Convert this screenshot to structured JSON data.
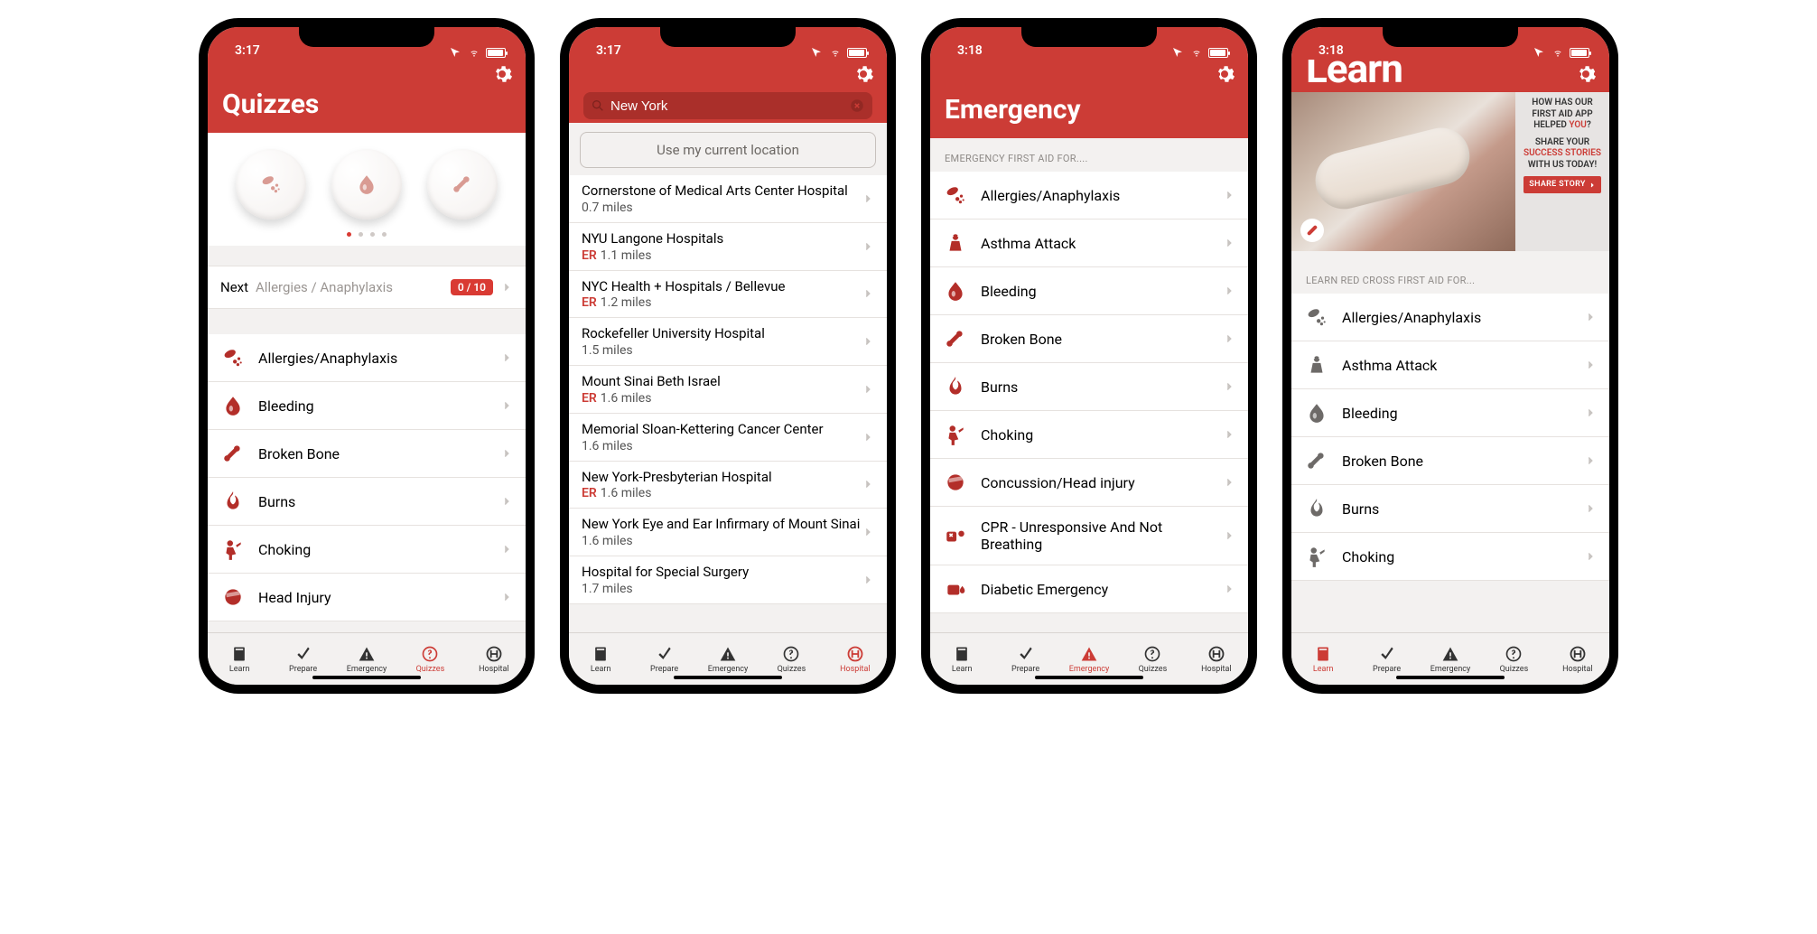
{
  "status": {
    "time_a": "3:17",
    "time_b": "3:18"
  },
  "colors": {
    "brand": "#cc3c36"
  },
  "tabs": {
    "learn": "Learn",
    "prepare": "Prepare",
    "emergency": "Emergency",
    "quizzes": "Quizzes",
    "hospital": "Hospital"
  },
  "screen1": {
    "title": "Quizzes",
    "next_label": "Next",
    "next_topic": "Allergies / Anaphylaxis",
    "badge": "0 / 10",
    "topics": [
      "Allergies/Anaphylaxis",
      "Bleeding",
      "Broken Bone",
      "Burns",
      "Choking",
      "Head Injury"
    ]
  },
  "screen2": {
    "search_value": "New York",
    "loc_btn": "Use my current location",
    "hospitals": [
      {
        "name": "Cornerstone of Medical Arts Center Hospital",
        "er": false,
        "dist": "0.7 miles"
      },
      {
        "name": "NYU Langone Hospitals",
        "er": true,
        "dist": "1.1 miles"
      },
      {
        "name": "NYC Health + Hospitals / Bellevue",
        "er": true,
        "dist": "1.2 miles"
      },
      {
        "name": "Rockefeller University Hospital",
        "er": false,
        "dist": "1.5 miles"
      },
      {
        "name": "Mount Sinai Beth Israel",
        "er": true,
        "dist": "1.6 miles"
      },
      {
        "name": "Memorial Sloan-Kettering Cancer Center",
        "er": false,
        "dist": "1.6 miles"
      },
      {
        "name": "New York-Presbyterian Hospital",
        "er": true,
        "dist": "1.6 miles"
      },
      {
        "name": "New York Eye and Ear Infirmary of Mount Sinai",
        "er": false,
        "dist": "1.6 miles"
      },
      {
        "name": "Hospital for Special Surgery",
        "er": false,
        "dist": "1.7 miles"
      }
    ],
    "er_label": "ER"
  },
  "screen3": {
    "title": "Emergency",
    "section": "EMERGENCY FIRST AID FOR....",
    "topics": [
      "Allergies/Anaphylaxis",
      "Asthma Attack",
      "Bleeding",
      "Broken Bone",
      "Burns",
      "Choking",
      "Concussion/Head injury",
      "CPR - Unresponsive And Not Breathing",
      "Diabetic Emergency"
    ]
  },
  "screen4": {
    "title": "Learn",
    "banner": {
      "line1": "HOW HAS OUR FIRST AID APP HELPED ",
      "you": "YOU",
      "q": "?",
      "line2a": "SHARE YOUR ",
      "succ": "SUCCESS STORIES",
      "line2b": " WITH US TODAY!",
      "cta": "SHARE STORY"
    },
    "section": "LEARN RED CROSS FIRST AID FOR...",
    "topics": [
      "Allergies/Anaphylaxis",
      "Asthma Attack",
      "Bleeding",
      "Broken Bone",
      "Burns",
      "Choking"
    ]
  }
}
